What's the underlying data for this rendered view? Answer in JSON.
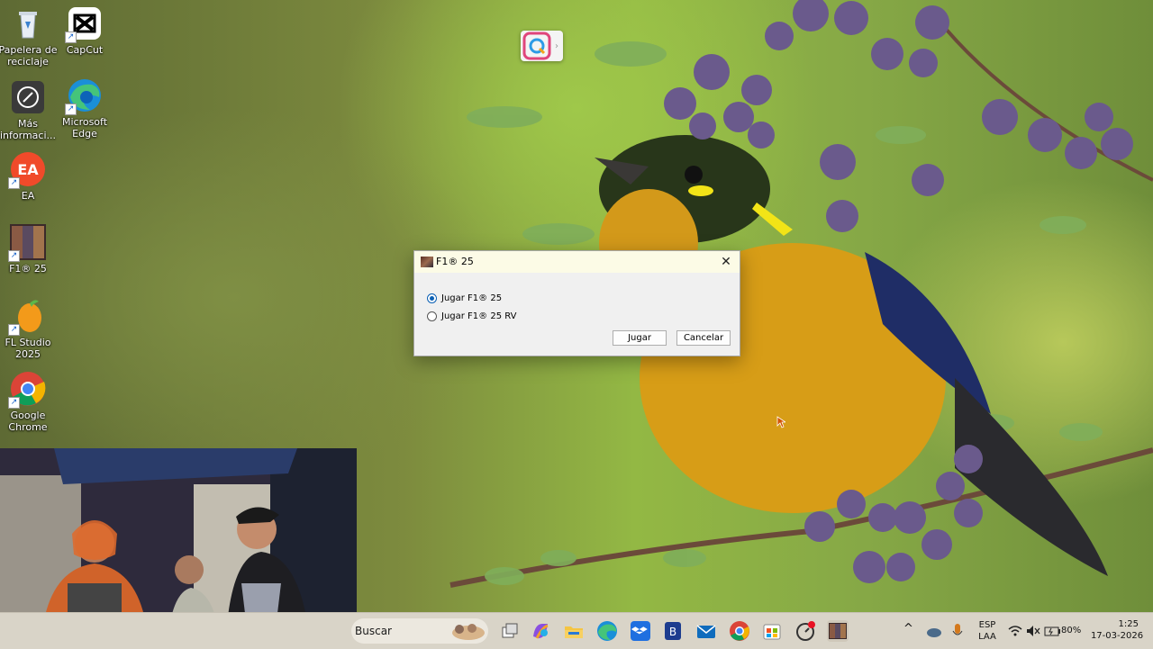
{
  "desktop": {
    "icons": [
      {
        "label": "Papelera de reciclaje",
        "icon": "recycle-bin-icon"
      },
      {
        "label": "CapCut",
        "icon": "capcut-icon"
      },
      {
        "label": "Más informaci...",
        "icon": "info-icon"
      },
      {
        "label": "Microsoft Edge",
        "icon": "edge-icon"
      },
      {
        "label": "EA",
        "icon": "ea-icon"
      },
      {
        "label": "F1® 25",
        "icon": "f1-25-icon"
      },
      {
        "label": "FL Studio 2025",
        "icon": "fl-studio-icon"
      },
      {
        "label": "Google Chrome",
        "icon": "chrome-icon"
      }
    ]
  },
  "dialog": {
    "title": "F1® 25",
    "options": [
      {
        "label": "Jugar F1® 25",
        "selected": true
      },
      {
        "label": "Jugar F1® 25 RV",
        "selected": false
      }
    ],
    "play_label": "Jugar",
    "cancel_label": "Cancelar",
    "close_glyph": "✕"
  },
  "taskbar": {
    "search_text": "Buscar",
    "pinned": [
      "widget-icon",
      "task-view-icon",
      "copilot-icon",
      "file-explorer-icon",
      "edge-icon",
      "dropbox-icon",
      "app-b-icon",
      "mail-icon",
      "chrome-icon",
      "store-icon",
      "fitness-app-icon",
      "f1-25-icon"
    ],
    "tray": {
      "chevron": "^",
      "language": "ESP",
      "layout": "LAA",
      "battery": "80%",
      "time": "1:25",
      "date": "17-03-2026"
    }
  },
  "colors": {
    "accent": "#0a5fb4",
    "dialog_title_bg": "#fcfbe6",
    "taskbar_bg": "#d9d4c8"
  }
}
